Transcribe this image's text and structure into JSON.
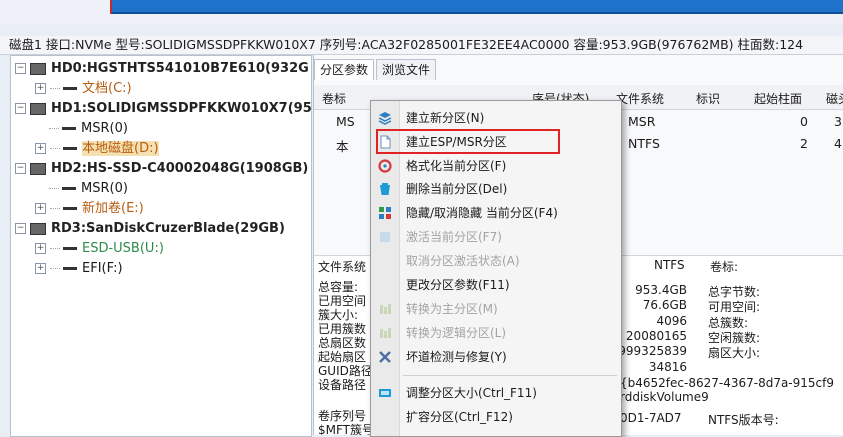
{
  "disk_info": "磁盘1 接口:NVMe 型号:SOLIDIGMSSDPFKKW010X7 序列号:ACA32F0285001FE32EE4AC0000 容量:953.9GB(976762MB) 柱面数:124",
  "tree": {
    "disks": [
      {
        "label": "HD0:HGSTHTS541010B7E610(932G",
        "partitions": [
          {
            "label": "文档(C:)",
            "style": "orange"
          }
        ]
      },
      {
        "label": "HD1:SOLIDIGMSSDPFKKW010X7(95",
        "partitions": [
          {
            "label": "MSR(0)",
            "style": "normal"
          },
          {
            "label": "本地磁盘(D:)",
            "style": "orange-hl"
          }
        ]
      },
      {
        "label": "HD2:HS-SSD-C40002048G(1908GB)",
        "partitions": [
          {
            "label": "MSR(0)",
            "style": "normal"
          },
          {
            "label": "新加卷(E:)",
            "style": "orange"
          }
        ]
      },
      {
        "label": "RD3:SanDiskCruzerBlade(29GB)",
        "partitions": [
          {
            "label": "ESD-USB(U:)",
            "style": "green"
          },
          {
            "label": "EFI(F:)",
            "style": "normal"
          }
        ]
      }
    ]
  },
  "tabs": [
    "分区参数",
    "浏览文件"
  ],
  "grid": {
    "headers": [
      "卷标",
      "序号(状态)",
      "文件系统",
      "标识",
      "起始柱面",
      "磁头"
    ],
    "rows": [
      {
        "name": "MS",
        "fs": "MSR",
        "start": "0",
        "head": "3"
      },
      {
        "name": "本",
        "fs": "NTFS",
        "start": "2",
        "head": "4"
      }
    ]
  },
  "props": {
    "fs_label": "文件系统",
    "fs_value": "NTFS",
    "vol_label": "卷标:",
    "left_labels": [
      "总容量:",
      "已用空间",
      "簇大小:",
      "已用簇数",
      "总扇区数",
      "起始扇区",
      "GUID路径",
      "设备路径"
    ],
    "values": [
      "953.4GB",
      "76.6GB",
      "4096",
      "20080165",
      "999325839",
      "34816"
    ],
    "right_labels": [
      "总字节数:",
      "可用空间:",
      "总簇数:",
      "空闲簇数:",
      "扇区大小:"
    ],
    "guid": "{b4652fec-8627-4367-8d7a-915cf9",
    "device": "rddiskVolume9",
    "serial_label": "卷序列号",
    "serial_value": "0D1-7AD7",
    "ntfs_ver_label": "NTFS版本号:",
    "mft_label": "$MFT簇号"
  },
  "menu": {
    "items": [
      {
        "label": "建立新分区(N)",
        "enabled": true,
        "icon": "layers-icon"
      },
      {
        "label": "建立ESP/MSR分区",
        "enabled": true,
        "icon": "document-icon"
      },
      {
        "label": "格式化当前分区(F)",
        "enabled": true,
        "icon": "format-icon"
      },
      {
        "label": "删除当前分区(Del)",
        "enabled": true,
        "icon": "trash-icon"
      },
      {
        "label": "隐藏/取消隐藏 当前分区(F4)",
        "enabled": true,
        "icon": "hide-icon"
      },
      {
        "label": "激活当前分区(F7)",
        "enabled": false,
        "icon": "activate-icon"
      },
      {
        "label": "取消分区激活状态(A)",
        "enabled": false,
        "icon": "none"
      },
      {
        "label": "更改分区参数(F11)",
        "enabled": true,
        "icon": "none"
      },
      {
        "label": "转换为主分区(M)",
        "enabled": false,
        "icon": "convert-icon"
      },
      {
        "label": "转换为逻辑分区(L)",
        "enabled": false,
        "icon": "convert-icon"
      },
      {
        "label": "坏道检测与修复(Y)",
        "enabled": true,
        "icon": "repair-icon"
      },
      {
        "label": "调整分区大小(Ctrl_F11)",
        "enabled": true,
        "icon": "resize-icon"
      },
      {
        "label": "扩容分区(Ctrl_F12)",
        "enabled": true,
        "icon": "none"
      }
    ]
  },
  "colors": {
    "accent": "#1e72c9",
    "highlight_box": "#e02424",
    "orange": "#b85d12",
    "green": "#2f8a4a"
  }
}
